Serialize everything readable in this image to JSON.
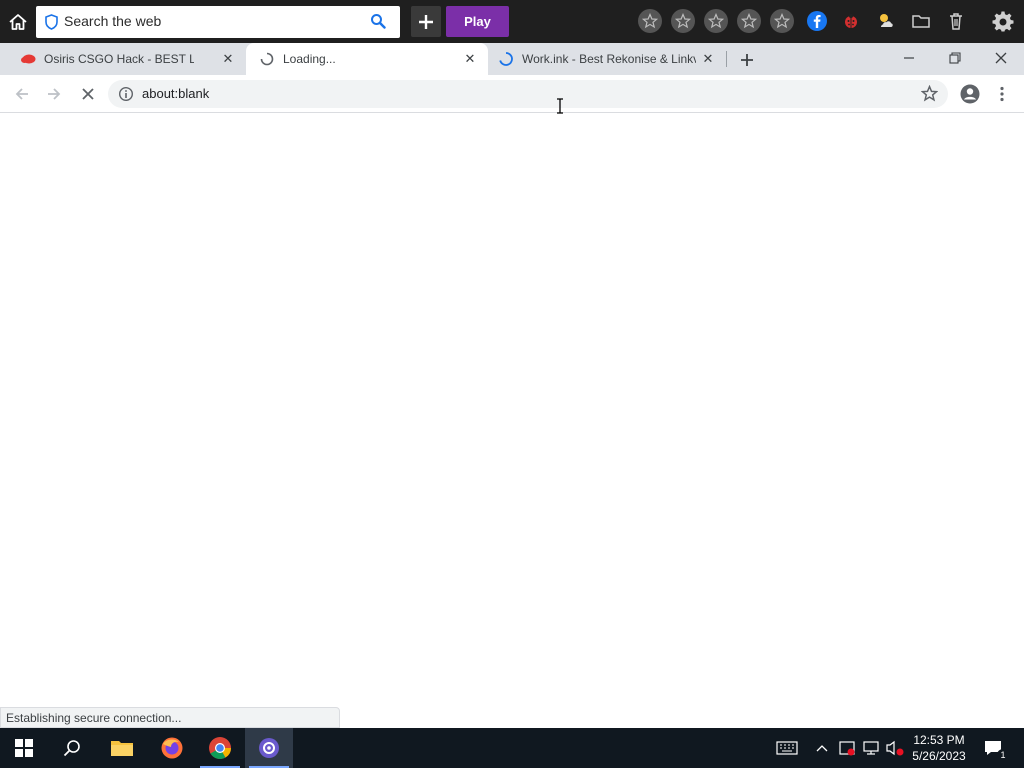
{
  "toolbar": {
    "search_placeholder": "Search the web",
    "play_label": "Play",
    "play_color": "#7b2fa8",
    "favorite_slots": 5,
    "icons": [
      "home-icon",
      "shield-icon",
      "search-icon",
      "plus-icon",
      "star-icon",
      "facebook-icon",
      "ladybug-icon",
      "weather-icon",
      "folder-icon",
      "trash-icon",
      "gear-icon"
    ]
  },
  "tabs": [
    {
      "title": "Osiris CSGO Hack - BEST Legit Ch",
      "favicon": "red-cloud-icon",
      "active": false
    },
    {
      "title": "Loading...",
      "favicon": "spinner-icon",
      "active": true
    },
    {
      "title": "Work.ink - Best Rekonise & Linkv",
      "favicon": "loading-ring-icon",
      "active": false
    }
  ],
  "address_bar": {
    "url": "about:blank"
  },
  "status": {
    "text": "Establishing secure connection..."
  },
  "taskbar": {
    "apps": [
      "windows-start-icon",
      "search-icon",
      "file-explorer-icon",
      "firefox-icon",
      "chrome-icon",
      "browser-app-icon"
    ],
    "clock": {
      "time": "12:53 PM",
      "date": "5/26/2023"
    },
    "notification_count": "1"
  }
}
